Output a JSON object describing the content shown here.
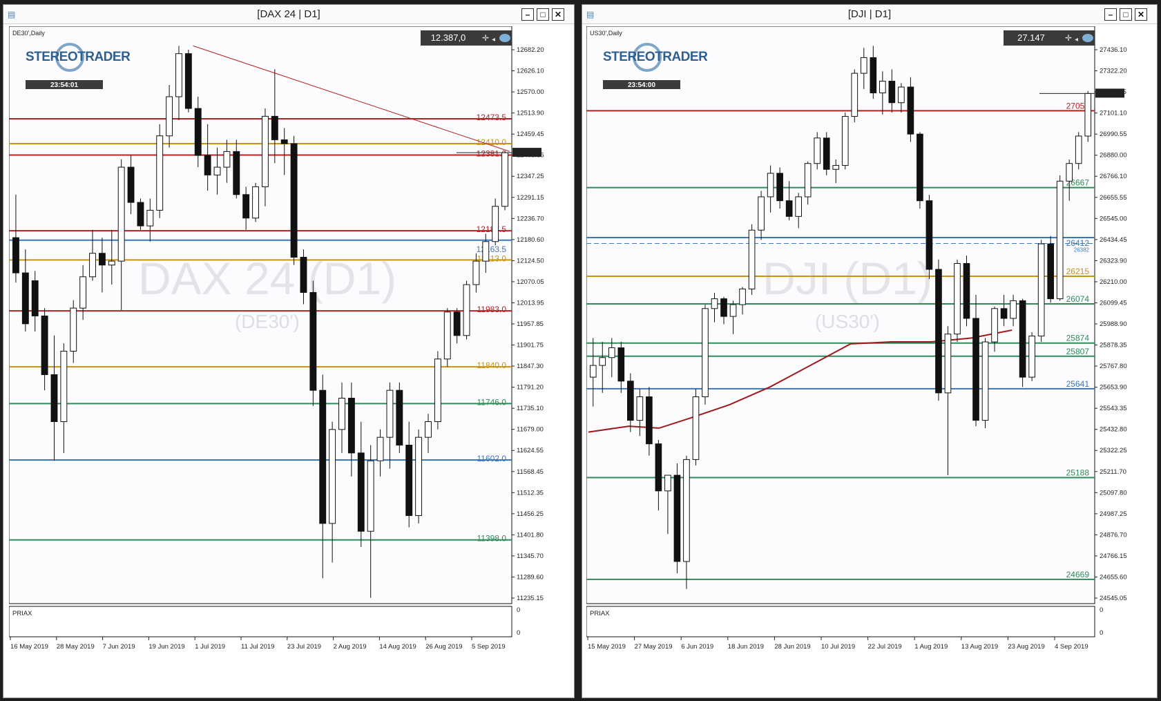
{
  "windows": [
    {
      "title": "[DAX 24 | D1]",
      "symbol_tf": "DE30',Daily",
      "price_box": "12.387,0",
      "clock": "23:54:01",
      "watermark": "DAX 24 (D1)",
      "watermark_sub": "(DE30')",
      "indicator_label": "PRIAX",
      "indicator_ticks": [
        "0",
        "0"
      ],
      "logo_text": "STEREOTRADER"
    },
    {
      "title": "[DJI | D1]",
      "symbol_tf": "US30',Daily",
      "price_box": "27.147",
      "clock": "23:54:00",
      "watermark": "DJI (D1)",
      "watermark_sub": "(US30')",
      "indicator_label": "PRIAX",
      "indicator_ticks": [
        "0",
        "0"
      ],
      "logo_text": "STEREOTRADER"
    }
  ],
  "chart_data": [
    {
      "type": "candlestick",
      "title": "[DAX 24 | D1]",
      "ylim": [
        11235.15,
        12710
      ],
      "y_ticks": [
        "12682.20",
        "12626.10",
        "12570.00",
        "12513.90",
        "12459.45",
        "12403.35",
        "12347.25",
        "12291.15",
        "12236.70",
        "12180.60",
        "12124.50",
        "12070.05",
        "12013.95",
        "11957.85",
        "11901.75",
        "11847.30",
        "11791.20",
        "11735.10",
        "11679.00",
        "11624.55",
        "11568.45",
        "11512.35",
        "11456.25",
        "11401.80",
        "11345.70",
        "11289.60",
        "11235.15"
      ],
      "x_labels": [
        "16 May 2019",
        "28 May 2019",
        "7 Jun 2019",
        "19 Jun 2019",
        "1 Jul 2019",
        "11 Jul 2019",
        "23 Jul 2019",
        "2 Aug 2019",
        "14 Aug 2019",
        "26 Aug 2019",
        "5 Sep 2019"
      ],
      "last_price": "12387.05",
      "levels": [
        {
          "label": "12473.5",
          "value": 12473.5,
          "color": "#b22222"
        },
        {
          "label": "12410.0",
          "value": 12410.0,
          "color": "#c8930c"
        },
        {
          "label": "12381.0",
          "value": 12381.0,
          "color": "#b22222"
        },
        {
          "label": "12187.5",
          "value": 12187.5,
          "color": "#b22222"
        },
        {
          "label": "12163.5",
          "value": 12163.5,
          "color": "#3a78b8"
        },
        {
          "label": "12113.0",
          "value": 12113.0,
          "color": "#c8930c"
        },
        {
          "label": "11983.0",
          "value": 11983.0,
          "color": "#b22222"
        },
        {
          "label": "11840.0",
          "value": 11840.0,
          "color": "#c8930c"
        },
        {
          "label": "11746.0",
          "value": 11746.0,
          "color": "#2e8b57"
        },
        {
          "label": "11602.0",
          "value": 11602.0,
          "color": "#3a78b8"
        },
        {
          "label": "11398.0",
          "value": 11398.0,
          "color": "#2e8b57"
        }
      ],
      "trendline": [
        [
          0.365,
          12660
        ],
        [
          1.0,
          12390
        ]
      ],
      "candles": [
        [
          12170,
          12280,
          12055,
          12080
        ],
        [
          12080,
          12140,
          11930,
          11950
        ],
        [
          12060,
          12085,
          11930,
          11970
        ],
        [
          11970,
          11990,
          11780,
          11820
        ],
        [
          11820,
          11920,
          11600,
          11700
        ],
        [
          11700,
          11900,
          11620,
          11880
        ],
        [
          11880,
          12010,
          11850,
          11990
        ],
        [
          11990,
          12100,
          11960,
          12070
        ],
        [
          12070,
          12190,
          12060,
          12130
        ],
        [
          12130,
          12170,
          12030,
          12100
        ],
        [
          12100,
          12190,
          12050,
          12110
        ],
        [
          12110,
          12370,
          11985,
          12350
        ],
        [
          12350,
          12380,
          12230,
          12260
        ],
        [
          12260,
          12270,
          12190,
          12200
        ],
        [
          12200,
          12270,
          12160,
          12240
        ],
        [
          12240,
          12460,
          12220,
          12430
        ],
        [
          12430,
          12560,
          12400,
          12530
        ],
        [
          12530,
          12660,
          12470,
          12640
        ],
        [
          12640,
          12650,
          12490,
          12500
        ],
        [
          12500,
          12530,
          12350,
          12380
        ],
        [
          12380,
          12460,
          12290,
          12330
        ],
        [
          12330,
          12400,
          12280,
          12350
        ],
        [
          12350,
          12420,
          12310,
          12390
        ],
        [
          12390,
          12420,
          12270,
          12280
        ],
        [
          12280,
          12300,
          12190,
          12220
        ],
        [
          12220,
          12310,
          12210,
          12300
        ],
        [
          12300,
          12500,
          12250,
          12480
        ],
        [
          12480,
          12600,
          12360,
          12420
        ],
        [
          12420,
          12450,
          12330,
          12410
        ],
        [
          12410,
          12430,
          12100,
          12120
        ],
        [
          12120,
          12140,
          12000,
          12030
        ],
        [
          12030,
          12060,
          11740,
          11780
        ],
        [
          11780,
          11820,
          11300,
          11440
        ],
        [
          11440,
          11700,
          11340,
          11680
        ],
        [
          11680,
          11800,
          11620,
          11760
        ],
        [
          11760,
          11800,
          11560,
          11620
        ],
        [
          11620,
          11700,
          11380,
          11420
        ],
        [
          11420,
          11640,
          11250,
          11600
        ],
        [
          11600,
          11680,
          11560,
          11660
        ],
        [
          11660,
          11800,
          11580,
          11780
        ],
        [
          11780,
          11800,
          11620,
          11640
        ],
        [
          11640,
          11700,
          11430,
          11460
        ],
        [
          11460,
          11680,
          11440,
          11660
        ],
        [
          11660,
          11720,
          11620,
          11700
        ],
        [
          11700,
          11880,
          11680,
          11860
        ],
        [
          11860,
          11990,
          11840,
          11980
        ],
        [
          11980,
          11990,
          11900,
          11920
        ],
        [
          11920,
          12060,
          11910,
          12050
        ],
        [
          12050,
          12130,
          12030,
          12110
        ],
        [
          12110,
          12180,
          12080,
          12160
        ],
        [
          12160,
          12270,
          12150,
          12250
        ],
        [
          12250,
          12390,
          12240,
          12387
        ]
      ]
    },
    {
      "type": "candlestick",
      "title": "[DJI | D1]",
      "ylim": [
        24545.05,
        27490
      ],
      "y_ticks": [
        "27436.10",
        "27322.20",
        "27211.65",
        "27101.10",
        "26990.55",
        "26880.00",
        "26766.10",
        "26655.55",
        "26545.00",
        "26434.45",
        "26323.90",
        "26210.00",
        "26099.45",
        "25988.90",
        "25878.35",
        "25767.80",
        "25653.90",
        "25543.35",
        "25432.80",
        "25322.25",
        "25211.70",
        "25097.80",
        "24987.25",
        "24876.70",
        "24766.15",
        "24655.60",
        "24545.05"
      ],
      "x_labels": [
        "15 May 2019",
        "27 May 2019",
        "6 Jun 2019",
        "18 Jun 2019",
        "28 Jun 2019",
        "10 Jul 2019",
        "22 Jul 2019",
        "1 Aug 2019",
        "13 Aug 2019",
        "23 Aug 2019",
        "4 Sep 2019"
      ],
      "last_price": "27147.00",
      "levels": [
        {
          "label": "27059",
          "value": 27059,
          "color": "#b22222"
        },
        {
          "label": "26667",
          "value": 26667,
          "color": "#2e8b57"
        },
        {
          "label": "26412",
          "value": 26412,
          "color": "#3a78b8"
        },
        {
          "label": "26382",
          "value": 26382,
          "color": "#3a78b8"
        },
        {
          "label": "26215",
          "value": 26215,
          "color": "#c8930c"
        },
        {
          "label": "26074",
          "value": 26074,
          "color": "#2e8b57"
        },
        {
          "label": "25874",
          "value": 25874,
          "color": "#2e8b57"
        },
        {
          "label": "25807",
          "value": 25807,
          "color": "#2e8b57"
        },
        {
          "label": "25641",
          "value": 25641,
          "color": "#3a78b8"
        },
        {
          "label": "25188",
          "value": 25188,
          "color": "#2e8b57"
        },
        {
          "label": "24669",
          "value": 24669,
          "color": "#2e8b57"
        }
      ],
      "moving_average": [
        [
          0.0,
          25420
        ],
        [
          0.08,
          25450
        ],
        [
          0.14,
          25440
        ],
        [
          0.2,
          25490
        ],
        [
          0.28,
          25560
        ],
        [
          0.36,
          25650
        ],
        [
          0.44,
          25760
        ],
        [
          0.52,
          25870
        ],
        [
          0.6,
          25880
        ],
        [
          0.68,
          25880
        ],
        [
          0.76,
          25900
        ],
        [
          0.84,
          25940
        ]
      ],
      "candles": [
        [
          25700,
          25900,
          25550,
          25760
        ],
        [
          25760,
          25880,
          25620,
          25800
        ],
        [
          25800,
          25900,
          25700,
          25850
        ],
        [
          25850,
          25880,
          25620,
          25680
        ],
        [
          25680,
          25720,
          25420,
          25480
        ],
        [
          25480,
          25640,
          25400,
          25600
        ],
        [
          25600,
          25650,
          25300,
          25360
        ],
        [
          25360,
          25380,
          25020,
          25120
        ],
        [
          25120,
          25200,
          24900,
          25200
        ],
        [
          25200,
          25260,
          24700,
          24760
        ],
        [
          24760,
          25300,
          24620,
          25280
        ],
        [
          25280,
          25640,
          25250,
          25600
        ],
        [
          25600,
          26070,
          25560,
          26050
        ],
        [
          26050,
          26130,
          25980,
          26100
        ],
        [
          26100,
          26110,
          25970,
          26010
        ],
        [
          26010,
          26090,
          25920,
          26070
        ],
        [
          26070,
          26160,
          26020,
          26150
        ],
        [
          26150,
          26480,
          26120,
          26450
        ],
        [
          26450,
          26650,
          26400,
          26620
        ],
        [
          26620,
          26780,
          26540,
          26740
        ],
        [
          26740,
          26770,
          26560,
          26600
        ],
        [
          26600,
          26700,
          26500,
          26520
        ],
        [
          26520,
          26640,
          26460,
          26620
        ],
        [
          26620,
          26800,
          26580,
          26790
        ],
        [
          26790,
          26950,
          26760,
          26920
        ],
        [
          26920,
          26950,
          26730,
          26760
        ],
        [
          26760,
          26810,
          26690,
          26780
        ],
        [
          26780,
          27050,
          26760,
          27030
        ],
        [
          27030,
          27270,
          27000,
          27250
        ],
        [
          27250,
          27380,
          27170,
          27330
        ],
        [
          27330,
          27390,
          27120,
          27150
        ],
        [
          27150,
          27260,
          27040,
          27210
        ],
        [
          27210,
          27270,
          27050,
          27100
        ],
        [
          27100,
          27200,
          27050,
          27180
        ],
        [
          27180,
          27230,
          26900,
          26940
        ],
        [
          26940,
          26950,
          26560,
          26600
        ],
        [
          26600,
          26630,
          26200,
          26250
        ],
        [
          26250,
          26300,
          25580,
          25620
        ],
        [
          25620,
          25960,
          25200,
          25920
        ],
        [
          25920,
          26300,
          25880,
          26280
        ],
        [
          26280,
          26320,
          25960,
          26000
        ],
        [
          26000,
          26120,
          25450,
          25480
        ],
        [
          25480,
          25900,
          25440,
          25880
        ],
        [
          25880,
          26060,
          25830,
          26050
        ],
        [
          26050,
          26120,
          25960,
          26000
        ],
        [
          26000,
          26120,
          25960,
          26090
        ],
        [
          26090,
          26100,
          25650,
          25700
        ],
        [
          25700,
          25930,
          25680,
          25910
        ],
        [
          25910,
          26400,
          25880,
          26380
        ],
        [
          26380,
          26420,
          26080,
          26100
        ],
        [
          26100,
          26730,
          26090,
          26700
        ],
        [
          26700,
          26810,
          26600,
          26790
        ],
        [
          26790,
          26950,
          26760,
          26930
        ],
        [
          26930,
          27160,
          26900,
          27147
        ]
      ]
    }
  ]
}
